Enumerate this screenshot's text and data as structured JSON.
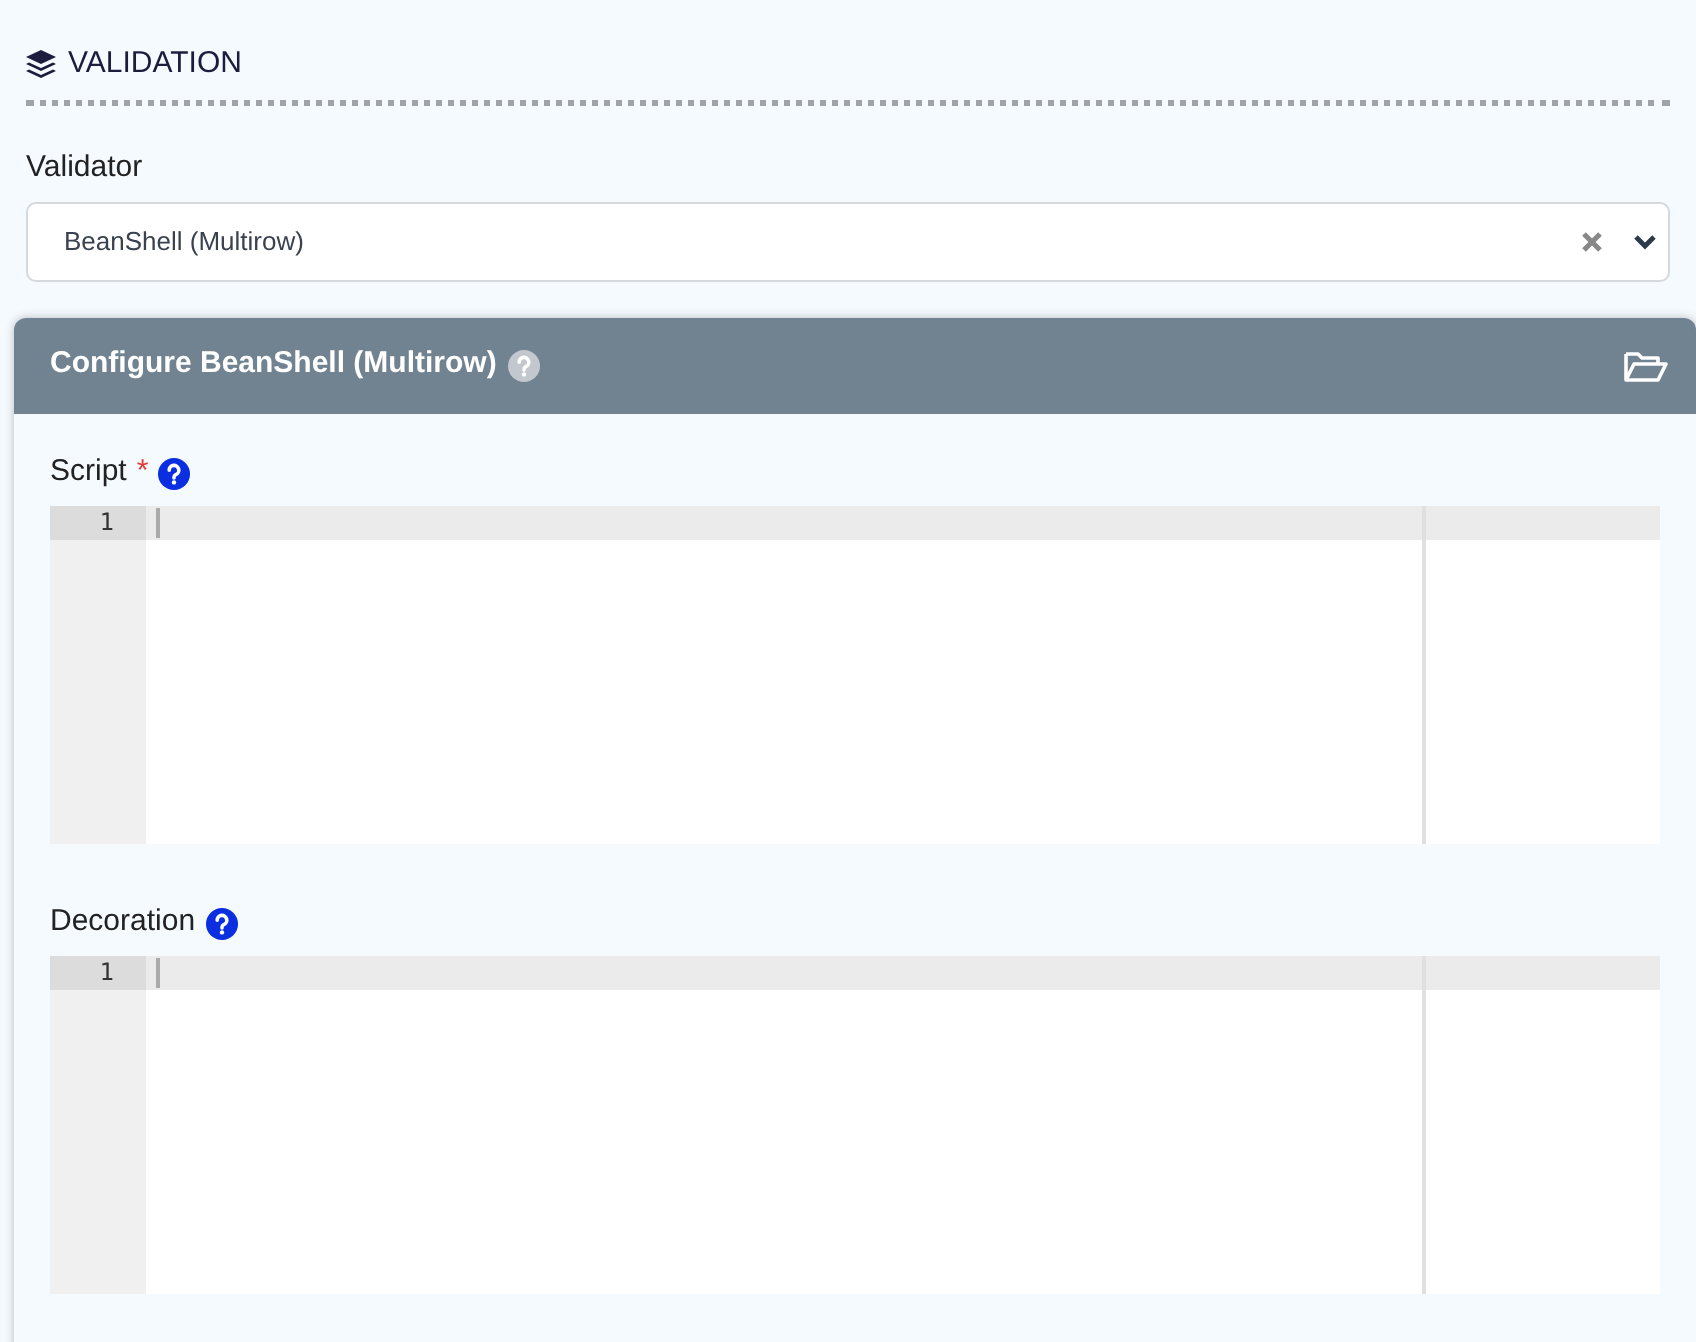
{
  "section": {
    "title": "VALIDATION"
  },
  "validator": {
    "label": "Validator",
    "value": "BeanShell (Multirow)"
  },
  "panel": {
    "title": "Configure BeanShell (Multirow)",
    "fields": [
      {
        "label": "Script",
        "required_mark": "*",
        "line_numbers": [
          "1"
        ]
      },
      {
        "label": "Decoration",
        "line_numbers": [
          "1"
        ]
      }
    ]
  }
}
